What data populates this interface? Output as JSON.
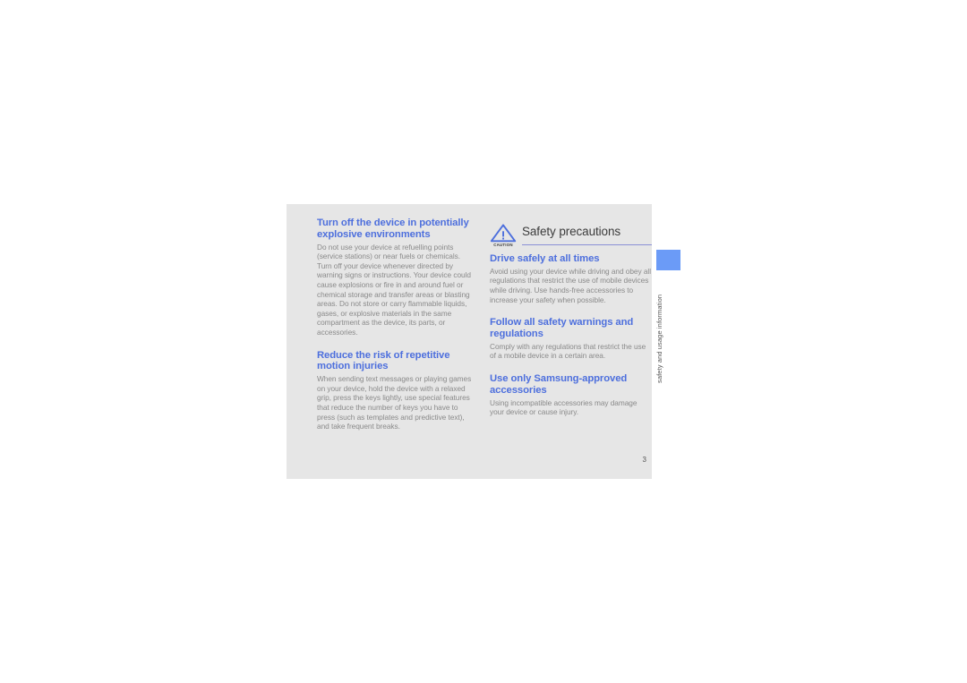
{
  "document": {
    "page_number": "3",
    "running_head": "safety and usage information",
    "colors": {
      "page_background": "#e6e6e6",
      "heading_blue": "#4d6fdd",
      "body_gray": "#8a8a8a",
      "tab_blue": "#6b9bf7",
      "rule_blue": "#8a8fd6",
      "title_dark": "#3b3b3b"
    }
  },
  "left_column": {
    "sections": [
      {
        "heading": "Turn off the device in potentially explosive environments",
        "body": "Do not use your device at refuelling points (service stations) or near fuels or chemicals. Turn off your device whenever directed by warning signs or instructions. Your device could cause explosions or fire in and around fuel or chemical storage and transfer areas or blasting areas. Do not store or carry flammable liquids, gases, or explosive materials in the same compartment as the device, its parts, or accessories."
      },
      {
        "heading": "Reduce the risk of repetitive motion injuries",
        "body": "When sending text messages or playing games on your device, hold the device with a relaxed grip, press the keys lightly, use special features that reduce the number of keys you have to press (such as templates and predictive text), and take frequent breaks."
      }
    ]
  },
  "right_column": {
    "header": {
      "icon_caption": "CAUTION",
      "title": "Safety precautions"
    },
    "sections": [
      {
        "heading": "Drive safely at all times",
        "body": "Avoid using your device while driving and obey all regulations that restrict the use of mobile devices while driving. Use hands-free accessories to increase your safety when possible."
      },
      {
        "heading": "Follow all safety warnings and regulations",
        "body": "Comply with any regulations that restrict the use of a mobile device in a certain area."
      },
      {
        "heading": "Use only Samsung-approved accessories",
        "body": "Using incompatible accessories may damage your device or cause injury."
      }
    ]
  }
}
